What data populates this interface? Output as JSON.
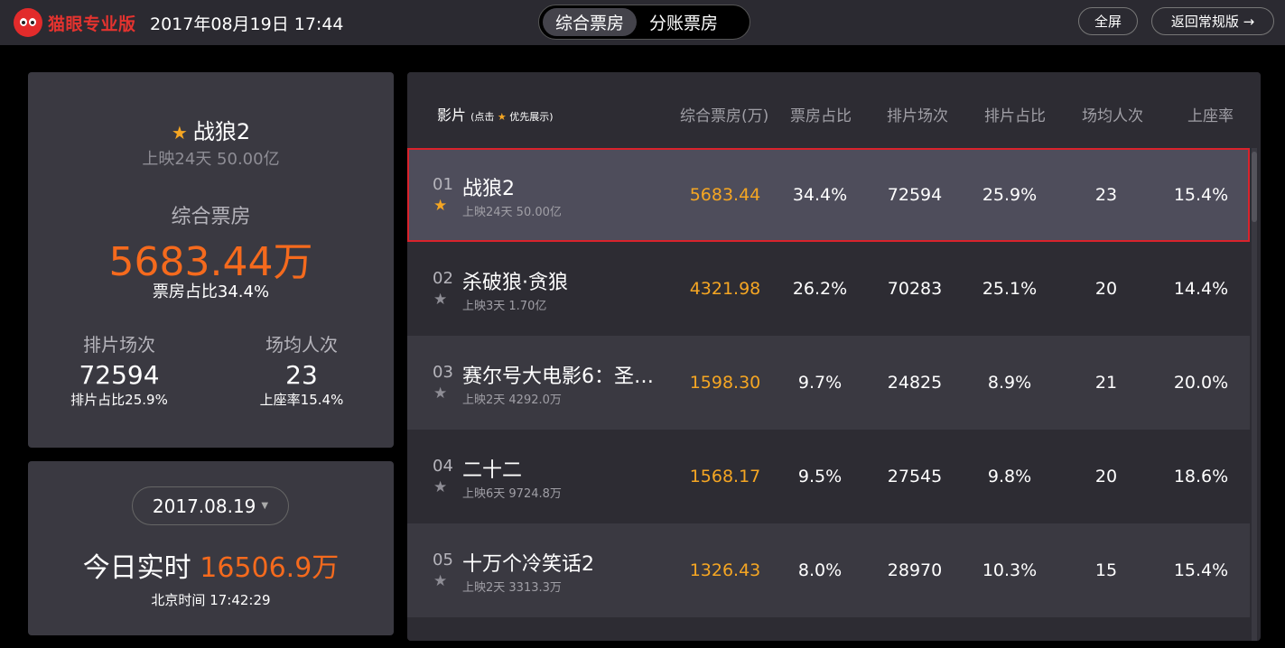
{
  "header": {
    "logo_text": "猫眼专业版",
    "datetime": "2017年08月19日 17:44",
    "tabs": [
      {
        "label": "综合票房",
        "active": true
      },
      {
        "label": "分账票房",
        "active": false
      }
    ],
    "fullscreen_label": "全屏",
    "back_label": "返回常规版 →"
  },
  "summary": {
    "film_title": "战狼2",
    "film_sub": "上映24天 50.00亿",
    "bo_label": "综合票房",
    "bo_value": "5683.44万",
    "bo_ratio": "票房占比34.4%",
    "shows_label": "排片场次",
    "shows_value": "72594",
    "shows_sub": "排片占比25.9%",
    "avg_label": "场均人次",
    "avg_value": "23",
    "avg_sub": "上座率15.4%"
  },
  "today": {
    "date": "2017.08.19",
    "label": "今日实时",
    "value": "16506.9万",
    "time": "北京时间 17:42:29"
  },
  "table": {
    "col_film": "影片",
    "col_film_hint_pre": "(点击",
    "col_film_hint_post": "优先展示)",
    "columns": [
      "综合票房(万)",
      "票房占比",
      "排片场次",
      "排片占比",
      "场均人次",
      "上座率"
    ],
    "rows": [
      {
        "idx": "01",
        "name": "战狼2",
        "meta": "上映24天  50.00亿",
        "bo": "5683.44",
        "bo_ratio": "34.4%",
        "shows": "72594",
        "show_ratio": "25.9%",
        "avg": "23",
        "seat": "15.4%",
        "starred": true
      },
      {
        "idx": "02",
        "name": "杀破狼·贪狼",
        "meta": "上映3天  1.70亿",
        "bo": "4321.98",
        "bo_ratio": "26.2%",
        "shows": "70283",
        "show_ratio": "25.1%",
        "avg": "20",
        "seat": "14.4%",
        "starred": false
      },
      {
        "idx": "03",
        "name": "赛尔号大电影6：圣…",
        "meta": "上映2天  4292.0万",
        "bo": "1598.30",
        "bo_ratio": "9.7%",
        "shows": "24825",
        "show_ratio": "8.9%",
        "avg": "21",
        "seat": "20.0%",
        "starred": false
      },
      {
        "idx": "04",
        "name": "二十二",
        "meta": "上映6天  9724.8万",
        "bo": "1568.17",
        "bo_ratio": "9.5%",
        "shows": "27545",
        "show_ratio": "9.8%",
        "avg": "20",
        "seat": "18.6%",
        "starred": false
      },
      {
        "idx": "05",
        "name": "十万个冷笑话2",
        "meta": "上映2天  3313.3万",
        "bo": "1326.43",
        "bo_ratio": "8.0%",
        "shows": "28970",
        "show_ratio": "10.3%",
        "avg": "15",
        "seat": "15.4%",
        "starred": false
      }
    ]
  },
  "colors": {
    "accent_orange": "#f56a1d",
    "bo_yellow": "#f5a623",
    "selected_border": "#d9232c",
    "brand_red": "#e4332f"
  }
}
